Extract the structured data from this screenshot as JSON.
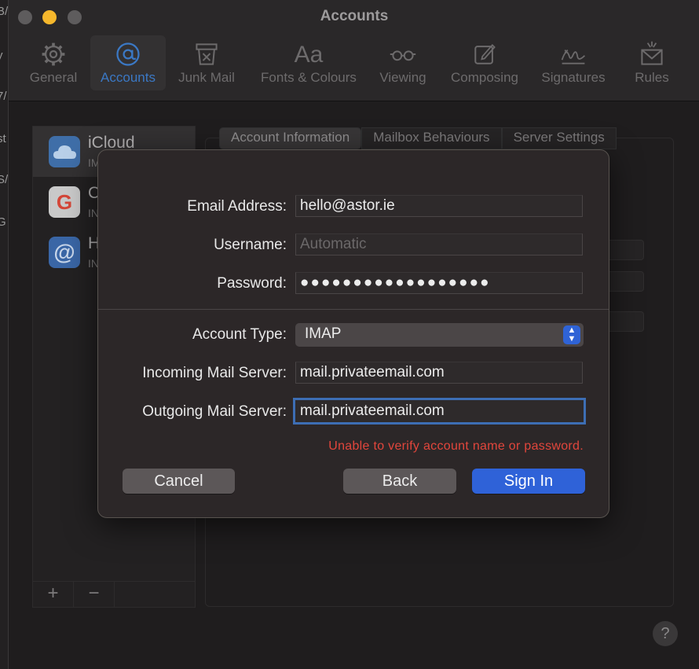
{
  "background_fragments": [
    "B/",
    "y",
    "7/",
    "st",
    "S/",
    "G"
  ],
  "window": {
    "title": "Accounts",
    "toolbar": [
      {
        "id": "general",
        "label": "General",
        "icon": "gear-icon"
      },
      {
        "id": "accounts",
        "label": "Accounts",
        "icon": "at-icon",
        "active": true
      },
      {
        "id": "junk",
        "label": "Junk Mail",
        "icon": "junk-bin-icon"
      },
      {
        "id": "fonts",
        "label": "Fonts & Colours",
        "icon": "font-aa-icon"
      },
      {
        "id": "viewing",
        "label": "Viewing",
        "icon": "glasses-icon"
      },
      {
        "id": "composing",
        "label": "Composing",
        "icon": "compose-icon"
      },
      {
        "id": "signatures",
        "label": "Signatures",
        "icon": "signature-icon"
      },
      {
        "id": "rules",
        "label": "Rules",
        "icon": "rules-envelope-icon"
      }
    ]
  },
  "sidebar": {
    "accounts": [
      {
        "name": "iCloud",
        "sub": "IM",
        "icon": "icloud-icon"
      },
      {
        "name": "C",
        "sub": "IN",
        "icon": "google-icon"
      },
      {
        "name": "H",
        "sub": "IN",
        "icon": "at-icon"
      }
    ],
    "add_label": "+",
    "remove_label": "−"
  },
  "tabs": [
    "Account Information",
    "Mailbox Behaviours",
    "Server Settings"
  ],
  "help_label": "?",
  "dialog": {
    "email_label": "Email Address:",
    "email_value": "hello@astor.ie",
    "username_label": "Username:",
    "username_placeholder": "Automatic",
    "password_label": "Password:",
    "password_value": "●●●●●●●●●●●●●●●●●●",
    "account_type_label": "Account Type:",
    "account_type_value": "IMAP",
    "incoming_label": "Incoming Mail Server:",
    "incoming_value": "mail.privateemail.com",
    "outgoing_label": "Outgoing Mail Server:",
    "outgoing_value": "mail.privateemail.com",
    "error": "Unable to verify account name or password.",
    "cancel_label": "Cancel",
    "back_label": "Back",
    "signin_label": "Sign In"
  },
  "colors": {
    "accent": "#2f62d8",
    "error": "#e2463c",
    "traffic_minimize": "#f5b72c"
  }
}
